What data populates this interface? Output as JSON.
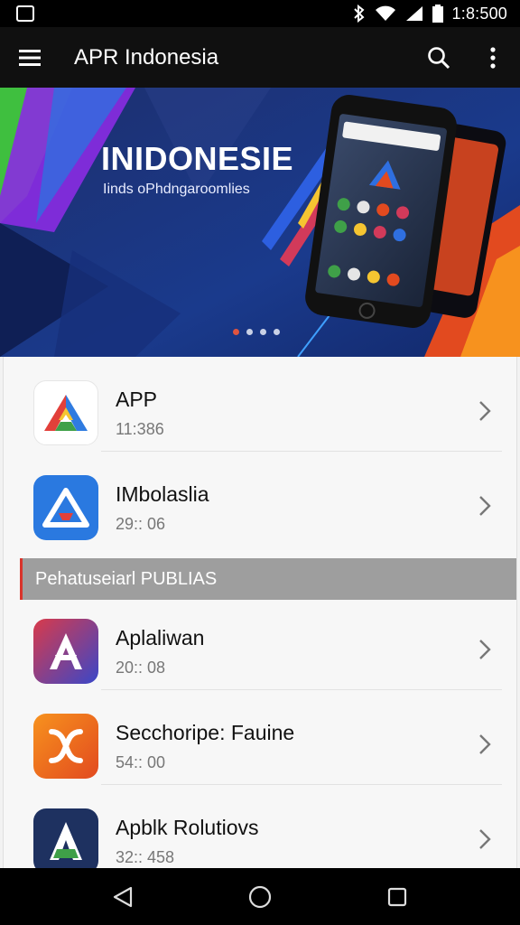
{
  "status_bar": {
    "time": "1:8:500",
    "icons": [
      "notification-icon",
      "bluetooth-icon",
      "wifi-icon",
      "signal-icon",
      "battery-icon"
    ]
  },
  "app_bar": {
    "title": "APR Indonesia",
    "actions": [
      "search-icon",
      "more-vert-icon"
    ]
  },
  "banner": {
    "title": "INIDONESIE",
    "subtitle": "Iinds oPhdngaroomlies",
    "slide_count": 4,
    "active_slide": 1
  },
  "list": {
    "top_items": [
      {
        "name": "APP",
        "sub": "11:386"
      },
      {
        "name": "IMbolaslia",
        "sub": "29:: 06"
      }
    ],
    "section_header": "Pehatuseiarl PUBLIAS",
    "section_items": [
      {
        "name": "Aplaliwan",
        "sub": "20:: 08"
      },
      {
        "name": "Secchoripe: Fauine",
        "sub": "54:: 00"
      },
      {
        "name": "Apblk Rolutiovs",
        "sub": "32:: 458"
      }
    ]
  },
  "nav_bar": {
    "buttons": [
      "back-icon",
      "home-icon",
      "recents-icon"
    ]
  },
  "colors": {
    "app_bar": "#101010",
    "section_header": "#9e9e9e",
    "accent_red": "#d9342b"
  }
}
